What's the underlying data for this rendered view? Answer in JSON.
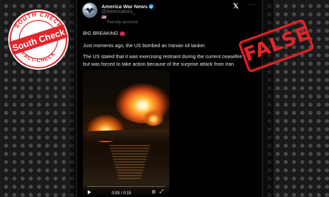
{
  "tweet": {
    "author": "America War News",
    "handle": "@Americalves_",
    "flag": "🇺🇸",
    "parody_label": "Parody account",
    "more_label": "···",
    "line1": "BIG BREAKING",
    "line2": "Just moments ago, the US bombed an Iranian oil tanker.",
    "line3a": "The US stated that it was exercising restraint during the current ceasefire",
    "line3b": "but was forced to take action because of the surprise attack from Iran"
  },
  "video": {
    "time": "0:05 / 0:15"
  },
  "badge": {
    "top_arc": "SOUTH CHECK",
    "bottom_arc": "FACT-CHECK",
    "center": "South Check"
  },
  "stamp": {
    "label": "FALSE"
  },
  "colors": {
    "stamp": "#e5232b",
    "badge_red": "#e3242b",
    "verified": "#1d9bf0"
  },
  "icons": [
    "avatar",
    "verified-icon",
    "x-logo-icon",
    "more-icon",
    "siren-icon",
    "play-icon",
    "settings-icon",
    "fullscreen-icon"
  ]
}
